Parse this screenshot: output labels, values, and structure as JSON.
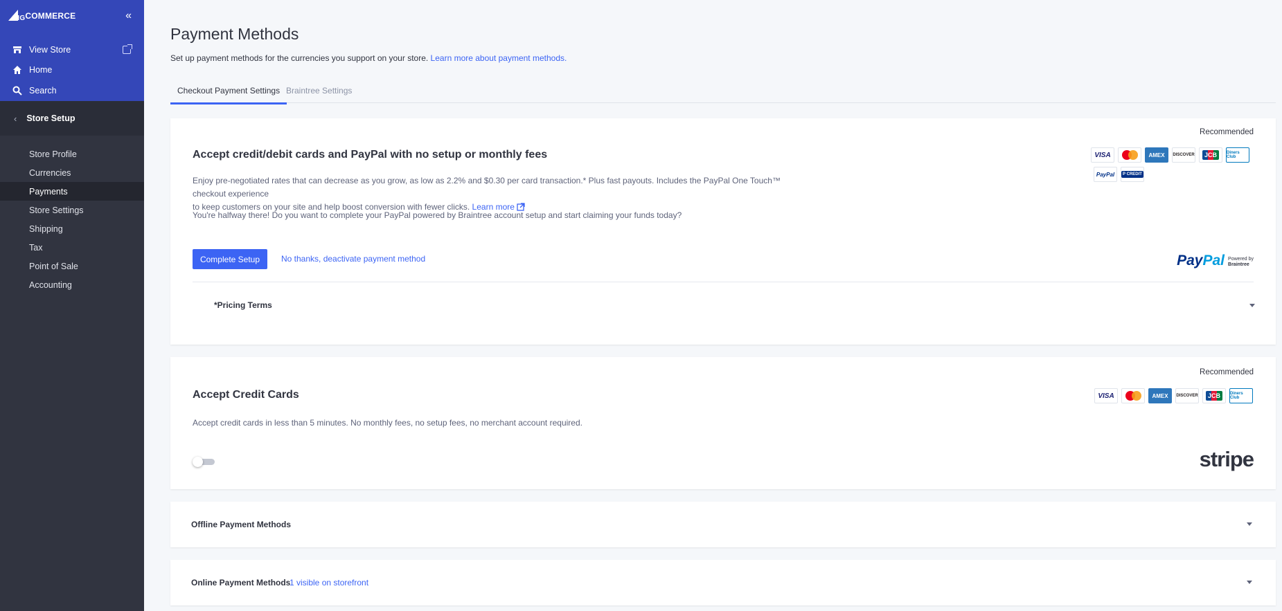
{
  "sidebar": {
    "brand": {
      "big": "BIG",
      "rest": "COMMERCE"
    },
    "top_links": [
      {
        "label": "View Store",
        "icon": "store-icon"
      },
      {
        "label": "Home",
        "icon": "home-icon"
      },
      {
        "label": "Search",
        "icon": "search-icon"
      }
    ],
    "section": "Store Setup",
    "items": [
      {
        "label": "Store Profile"
      },
      {
        "label": "Currencies"
      },
      {
        "label": "Payments",
        "active": true
      },
      {
        "label": "Store Settings"
      },
      {
        "label": "Shipping"
      },
      {
        "label": "Tax"
      },
      {
        "label": "Point of Sale"
      },
      {
        "label": "Accounting"
      }
    ]
  },
  "header": {
    "title": "Payment Methods",
    "subtitle": "Set up payment methods for the currencies you support on your store.",
    "subtitle_link": "Learn more about payment methods."
  },
  "tabs": [
    {
      "label": "Checkout Payment Settings",
      "active": true
    },
    {
      "label": "Braintree Settings",
      "active": false
    }
  ],
  "paypal_card": {
    "badge": "Recommended",
    "title": "Accept credit/debit cards and PayPal with no setup or monthly fees",
    "desc_line1": "Enjoy pre-negotiated rates that can decrease as you grow, as low as 2.2% and $0.30 per card transaction.* Plus fast payouts. Includes the PayPal One Touch™ checkout experience",
    "desc_line2": "to keep customers on your site and help boost conversion with fewer clicks.",
    "learn_more": "Learn more",
    "halfway": "You're halfway there! Do you want to complete your PayPal powered by Braintree account setup and start claiming your funds today?",
    "primary_button": "Complete Setup",
    "secondary_link": "No thanks, deactivate payment method",
    "pricing_terms": "*Pricing Terms",
    "card_logos": {
      "visa": "VISA",
      "amex": "AMEX",
      "discover": "DISCOVER",
      "jcb": "JCB",
      "diners": "Diners Club",
      "paypal": "PayPal",
      "paypal_credit": "P CREDIT"
    },
    "logo": {
      "pay": "Pay",
      "pal": "Pal",
      "powered": "Powered by",
      "braintree": "Braintree"
    }
  },
  "stripe_card": {
    "badge": "Recommended",
    "title": "Accept Credit Cards",
    "desc": "Accept credit cards in less than 5 minutes. No monthly fees, no setup fees, no merchant account required.",
    "toggle_on": false,
    "logo": "stripe"
  },
  "offline_panel": {
    "title": "Offline Payment Methods"
  },
  "online_panel": {
    "title": "Online Payment Methods",
    "badge": "1 visible on storefront"
  },
  "colors": {
    "primary": "#3c64f4",
    "sidebar": "#313440",
    "sidebar_top": "#3447b8"
  }
}
